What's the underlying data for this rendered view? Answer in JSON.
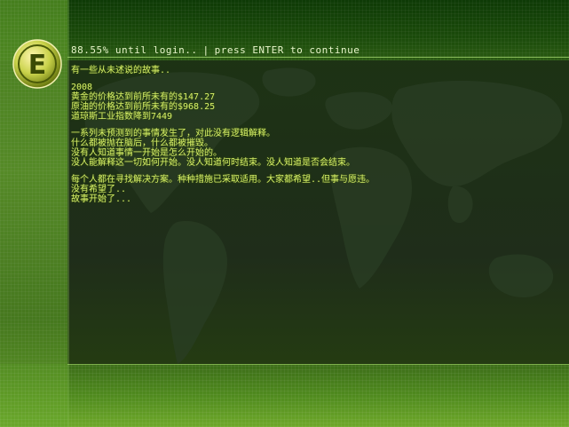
{
  "header": {
    "progress_text": "88.55% until login..",
    "separator": "|",
    "prompt_text": "press ENTER to continue"
  },
  "logo": {
    "glyph": "E",
    "icon": "e-emblem-icon"
  },
  "story": {
    "intro": "有一些从未述说的故事..",
    "year": "2008",
    "facts": [
      "黄金的价格达到前所未有的$147.27",
      "原油的价格达到前所未有的$968.25",
      "道琼斯工业指数降到7449"
    ],
    "paragraph1": [
      "一系列未预测到的事情发生了，对此没有逻辑解释。",
      "什么都被抛在脑后，什么都被摧毁。",
      "没有人知道事情一开始是怎么开始的。",
      "没人能解释这一切如何开始。没人知道何时结束。没人知道是否会结束。"
    ],
    "paragraph2": [
      "每个人都在寻找解决方案。种种措施已采取适用。大家都希望..但事与愿违。",
      "没有希望了..",
      "故事开始了..."
    ]
  },
  "colors": {
    "accent_green": "#5f9a2a",
    "story_text": "#d8f06a",
    "header_text": "#e6f4c9"
  }
}
